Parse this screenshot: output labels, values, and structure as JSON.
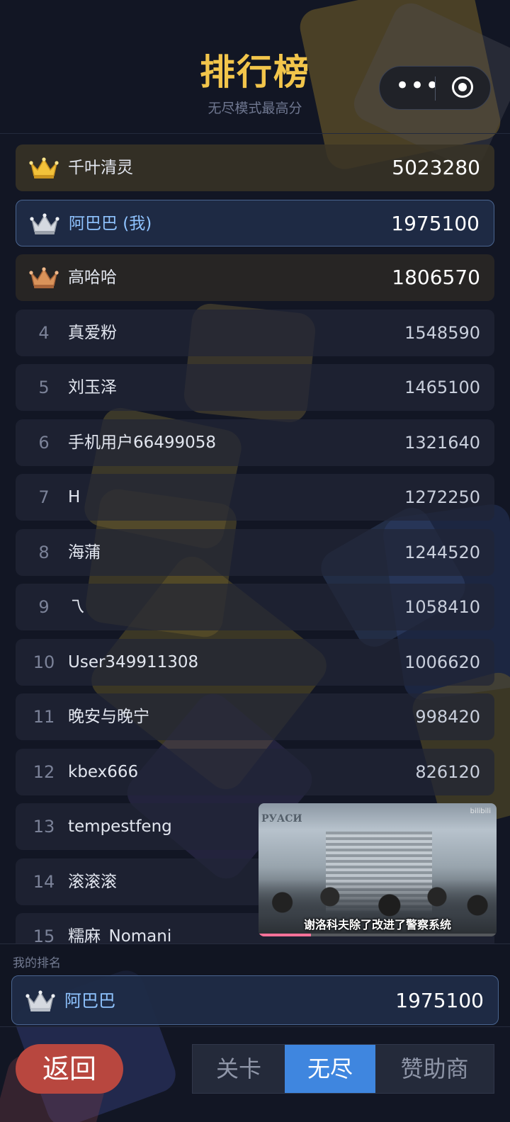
{
  "header": {
    "title": "排行榜",
    "subtitle": "无尽模式最高分"
  },
  "capsule": {
    "more_icon": "more-dots-icon",
    "close_icon": "target-close-icon"
  },
  "leaderboard": [
    {
      "rank": "1",
      "name": "千叶清灵",
      "score": "5023280",
      "medal": "gold"
    },
    {
      "rank": "2",
      "name": "阿巴巴 (我)",
      "score": "1975100",
      "medal": "silver",
      "is_me": true
    },
    {
      "rank": "3",
      "name": "高哈哈",
      "score": "1806570",
      "medal": "bronze"
    },
    {
      "rank": "4",
      "name": "真爱粉",
      "score": "1548590"
    },
    {
      "rank": "5",
      "name": "刘玉泽",
      "score": "1465100"
    },
    {
      "rank": "6",
      "name": "手机用户66499058",
      "score": "1321640"
    },
    {
      "rank": "7",
      "name": "H",
      "score": "1272250"
    },
    {
      "rank": "8",
      "name": "海蒲",
      "score": "1244520"
    },
    {
      "rank": "9",
      "name": "乁",
      "score": "1058410"
    },
    {
      "rank": "10",
      "name": "User349911308",
      "score": "1006620"
    },
    {
      "rank": "11",
      "name": "晚安与晚宁",
      "score": "998420"
    },
    {
      "rank": "12",
      "name": "kbex666",
      "score": "826120"
    },
    {
      "rank": "13",
      "name": "tempestfeng",
      "score": ""
    },
    {
      "rank": "14",
      "name": "滚滚滚",
      "score": ""
    },
    {
      "rank": "15",
      "name": "糯麻_Nomani",
      "score": ""
    }
  ],
  "video_overlay": {
    "caption": "谢洛科夫除了改进了警察系统",
    "sign_text": "РУАСИ",
    "watermark": "bilibili",
    "progress": 0.22
  },
  "my_rank": {
    "label": "我的排名",
    "name": "阿巴巴",
    "score": "1975100",
    "medal": "silver"
  },
  "footer": {
    "back_label": "返回",
    "tabs": [
      {
        "label": "关卡",
        "active": false
      },
      {
        "label": "无尽",
        "active": true
      },
      {
        "label": "赞助商",
        "active": false
      }
    ]
  },
  "colors": {
    "accent": "#3f86df",
    "title_gold": "#f2c54b",
    "back_button": "#b8473f",
    "my_row_border": "#4a6590"
  }
}
